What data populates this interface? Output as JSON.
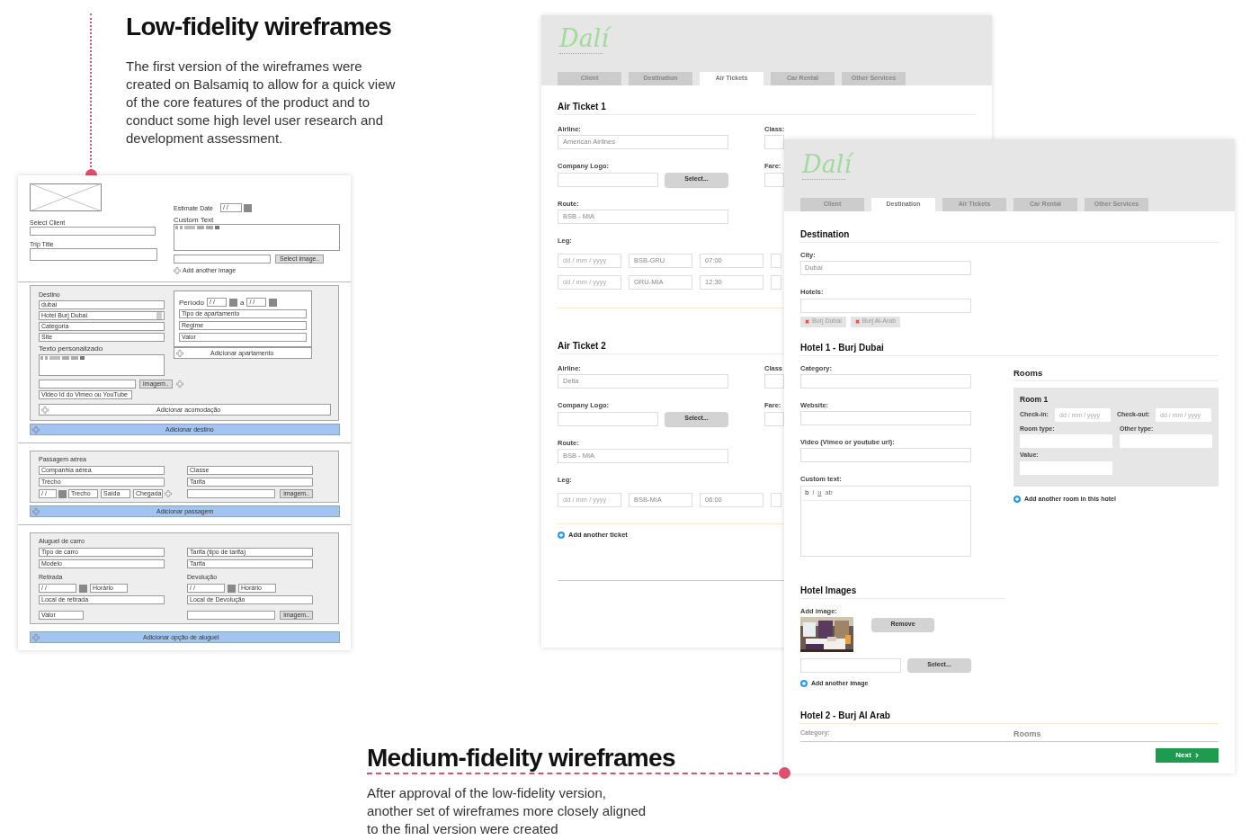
{
  "intro": {
    "title": "Low-fidelity wireframes",
    "text": "The first version of the wireframes were created on Balsamiq to allow for a quick view of the core features of the product and to conduct some high level user research and development assessment."
  },
  "lowfi": {
    "estimate_label": "Estimate Date",
    "estimate_date": "/ /",
    "select_client_label": "Select Client",
    "trip_title_label": "Trip Title",
    "custom_text_label": "Custom Text",
    "select_image": "Select image..",
    "add_image": "Add another image",
    "destination": {
      "label": "Destino",
      "city": "dubai",
      "hotel": "Hotel Burj Dubai",
      "fields": [
        "Categoria",
        "Site"
      ],
      "custom_text_label": "Texto personalizado",
      "image_button": "imagem..",
      "video": "Video Id do Vimeo ou YouTube",
      "add_accommodation": "Adicionar acomodação",
      "period_label": "Período",
      "period_from": "/ /",
      "period_to_label": "a",
      "period_to": "/ /",
      "room_fields": [
        "Tipo de apartamento",
        "Regime",
        "Valor"
      ],
      "add_room": "Adicionar apartamento",
      "add_bar": "Adicionar destino"
    },
    "flight": {
      "label": "Passagem aérea",
      "left_fields": [
        "Companhia aérea",
        "Trecho"
      ],
      "right_fields": [
        "Classe",
        "Tarifa"
      ],
      "date": "/ /",
      "leg_fields": [
        "Trecho",
        "Saída",
        "Chegada"
      ],
      "image_button": "imagem..",
      "add_bar": "Adicionar passagem"
    },
    "car": {
      "label": "Aluguel de carro",
      "left_fields": [
        "Tipo de carro",
        "Modelo"
      ],
      "right_fields": [
        "Tarifa (tipo de tarifa)",
        "Tarifa"
      ],
      "pickup_label": "Retirada",
      "pickup_date": "/ /",
      "pickup_time": "Horário",
      "pickup_place": "Local de retirada",
      "return_label": "Devolução",
      "return_date": "/ /",
      "return_time": "Horário",
      "return_place": "Local de Devolução",
      "value": "Valor",
      "image_button": "imagem..",
      "add_bar": "Adicionar opção de aluguel"
    }
  },
  "medium": {
    "title": "Medium-fidelity wireframes",
    "text": "After approval of the low-fidelity version, another set of wireframes more closely aligned to the final version were created"
  },
  "air_window": {
    "logo": "Dalí",
    "tabs": [
      {
        "label": "Client",
        "selected": false
      },
      {
        "label": "Destination",
        "selected": false
      },
      {
        "label": "Air Tickets",
        "selected": true
      },
      {
        "label": "Car Rental",
        "selected": false
      },
      {
        "label": "Other Services",
        "selected": false
      }
    ],
    "tickets": [
      {
        "title": "Air Ticket 1",
        "airline_label": "Airline:",
        "airline": "American Airlines",
        "class_label": "Class:",
        "logo_label": "Company Logo:",
        "select": "Select...",
        "fare_label": "Fare:",
        "route_label": "Route:",
        "route": "BSB - MIA",
        "leg_label": "Leg:",
        "legs": [
          {
            "date": "dd / mm / yyyy",
            "route": "BSB-GRU",
            "time": "07:00"
          },
          {
            "date": "dd / mm / yyyy",
            "route": "GRU-MIA",
            "time": "12:30"
          }
        ]
      },
      {
        "title": "Air Ticket 2",
        "airline_label": "Airline:",
        "airline": "Delta",
        "class_label": "Class",
        "logo_label": "Company Logo:",
        "select": "Select...",
        "fare_label": "Fare:",
        "route_label": "Route:",
        "route": "BSB - MIA",
        "leg_label": "Leg:",
        "legs": [
          {
            "date": "dd / mm / yyyy",
            "route": "BSB-MIA",
            "time": "06:00"
          }
        ]
      }
    ],
    "add_ticket": "Add another ticket"
  },
  "destination_window": {
    "logo": "Dalí",
    "tabs": [
      {
        "label": "Client",
        "selected": false
      },
      {
        "label": "Destination",
        "selected": true
      },
      {
        "label": "Air Tickets",
        "selected": false
      },
      {
        "label": "Car Rental",
        "selected": false
      },
      {
        "label": "Other Services",
        "selected": false
      }
    ],
    "title": "Destination",
    "city_label": "City:",
    "city": "Dubai",
    "hotels_label": "Hotels:",
    "hotels": [
      "Burj Dubai",
      "Burj Al-Arab"
    ],
    "hotel_title": "Hotel 1 - Burj Dubai",
    "category_label": "Category:",
    "website_label": "Website:",
    "video_label": "Video (Vimeo or youtube url):",
    "custom_text_label": "Custom text:",
    "editor_tools": [
      "b",
      "i",
      "u",
      "ab"
    ],
    "rooms_title": "Rooms",
    "room_title": "Room 1",
    "checkin_label": "Check-in:",
    "checkin": "dd / mm / yyyy",
    "checkout_label": "Check-out:",
    "checkout": "dd / mm / yyyy",
    "room_type_label": "Room type:",
    "other_type_label": "Other type:",
    "value_label": "Value:",
    "add_room": "Add another room in this hotel",
    "images_title": "Hotel Images",
    "add_image_label": "Add image:",
    "remove": "Remove",
    "select": "Select...",
    "add_image": "Add another image",
    "hotel2_title": "Hotel 2 - Burj Al Arab",
    "hotel2_category_label": "Category:",
    "hotel2_rooms": "Rooms",
    "next": "Next"
  }
}
